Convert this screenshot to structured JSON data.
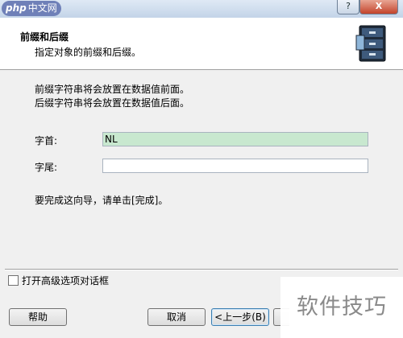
{
  "titlebar": {
    "logo_text": "php",
    "logo_cn": "中文网",
    "help_glyph": "?",
    "close_glyph": "X"
  },
  "header": {
    "title": "前缀和后缀",
    "subtitle": "指定对象的前缀和后缀。",
    "icon": "filing-cabinet-icon"
  },
  "description": {
    "line1": "前缀字符串将会放置在数据值前面。",
    "line2": "后缀字符串将会放置在数据值后面。"
  },
  "prefix_field": {
    "label": "字首:",
    "value": "NL"
  },
  "suffix_field": {
    "label": "字尾:",
    "value": ""
  },
  "finish_text": "要完成这向导，请单击[完成]。",
  "advanced_checkbox": {
    "label": "打开高级选项对话框",
    "checked": false
  },
  "buttons": {
    "help": "帮助",
    "cancel": "取消",
    "back": "<上一步(B)"
  },
  "watermark": "软件技巧"
}
